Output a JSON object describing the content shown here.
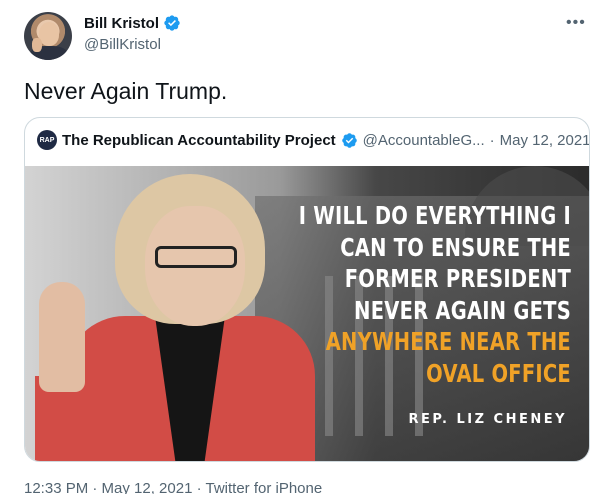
{
  "author": {
    "display_name": "Bill Kristol",
    "handle": "@BillKristol",
    "verified": true
  },
  "more_icon": "ellipsis-icon",
  "tweet": {
    "text": "Never Again Trump.",
    "meta": "12:33 PM · May 12, 2021 · Twitter for iPhone"
  },
  "quoted": {
    "avatar_text": "RAP",
    "display_name": "The Republican Accountability Project",
    "handle": "@AccountableG...",
    "separator": "·",
    "date": "May 12, 2021",
    "verified": true,
    "image": {
      "quote_white": [
        "I WILL DO EVERYTHING I",
        "CAN TO ENSURE THE",
        "FORMER PRESIDENT",
        "NEVER AGAIN GETS"
      ],
      "quote_yellow": [
        "ANYWHERE NEAR THE",
        "OVAL OFFICE"
      ],
      "attribution": "REP. LIZ CHENEY"
    }
  },
  "colors": {
    "verified_blue": "#1d9bf0",
    "highlight_yellow": "#f0a227",
    "jacket_red": "#d24c46",
    "secondary_text": "#536471"
  }
}
